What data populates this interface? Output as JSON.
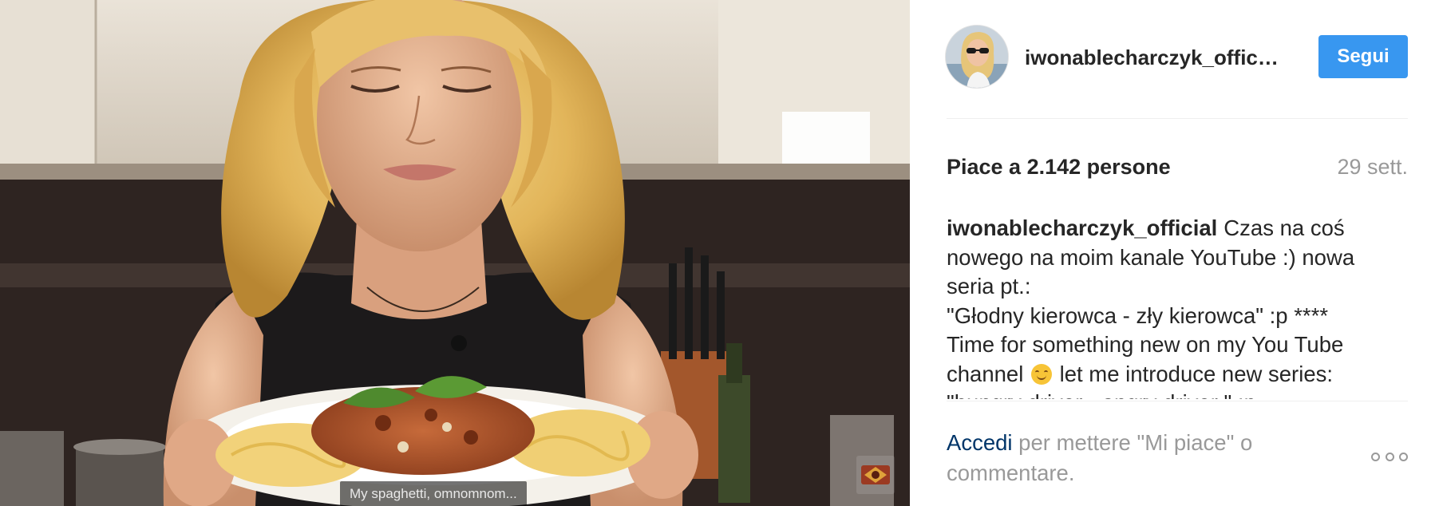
{
  "post": {
    "subtitle": "My spaghetti, omnomnom...",
    "watermark_icon": "channel-logo"
  },
  "header": {
    "username": "iwonablecharczyk_official",
    "follow_label": "Segui",
    "avatar_icon": "profile-avatar"
  },
  "stats": {
    "likes": "Piace a 2.142 persone",
    "date": "29 sett."
  },
  "caption": {
    "user": "iwonablecharczyk_official",
    "lines": [
      "Czas na coś",
      "nowego na moim kanale YouTube :) nowa",
      "seria pt.:",
      "\"Głodny kierowca - zły kierowca\" :p ****",
      "Time for something new on my You Tube",
      "channel",
      " let me introduce new series:",
      "\"hungry driver - angry driver \" :p"
    ],
    "emoji": "smiling-face-emoji"
  },
  "footer": {
    "login_link": "Accedi",
    "login_rest": " per mettere \"Mi piace\" o commentare.",
    "more_icon": "more-options-icon"
  },
  "colors": {
    "accent": "#3897f0",
    "link": "#003569",
    "muted": "#999999",
    "text": "#262626"
  }
}
